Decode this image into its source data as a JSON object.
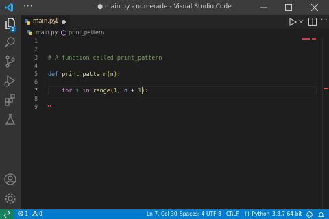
{
  "window": {
    "title": "● main.py - numerade - Visual Studio Code",
    "menu_label": "···"
  },
  "activity_bar": {
    "items": [
      {
        "name": "explorer",
        "icon": "files-icon"
      },
      {
        "name": "search",
        "icon": "search-icon"
      },
      {
        "name": "source-control",
        "icon": "source-control-icon"
      },
      {
        "name": "run-debug",
        "icon": "run-debug-icon"
      },
      {
        "name": "extensions",
        "icon": "extensions-icon"
      },
      {
        "name": "testing",
        "icon": "flask-icon"
      }
    ],
    "explorer_badge": "1",
    "bottom": [
      {
        "name": "accounts",
        "icon": "account-icon"
      },
      {
        "name": "manage",
        "icon": "gear-icon"
      }
    ]
  },
  "tabs": [
    {
      "label": "main.py",
      "problems": "1",
      "dirty": true,
      "active": true
    }
  ],
  "editor_actions": {
    "more_label": "···"
  },
  "breadcrumb": {
    "file": "main.py",
    "separator": "›",
    "symbol": "print_pattern"
  },
  "editor": {
    "active_line": 7,
    "lines": [
      {
        "num": "1",
        "text": ""
      },
      {
        "num": "2",
        "text": ""
      },
      {
        "num": "3",
        "text": "# A function called print_pattern"
      },
      {
        "num": "4",
        "text": ""
      },
      {
        "num": "5",
        "text": "def print_pattern(n):"
      },
      {
        "num": "6",
        "text": ""
      },
      {
        "num": "7",
        "text": "    for i in range(1, n + 1):"
      },
      {
        "num": "8",
        "text": ""
      },
      {
        "num": "9",
        "text": ""
      }
    ]
  },
  "status_bar": {
    "errors": "1",
    "warnings": "0",
    "position": "Ln 7, Col 30",
    "spaces": "Spaces: 4",
    "encoding": "UTF-8",
    "eol": "CRLF",
    "language": "Python",
    "interpreter": "3.8.7 64-bit"
  },
  "colors": {
    "status_bar": "#007acc",
    "remote": "#16825d",
    "activity_bar": "#333333",
    "editor_bg": "#1e1e1e",
    "modified_tab": "#e2c08d",
    "error": "#f14c4c"
  }
}
